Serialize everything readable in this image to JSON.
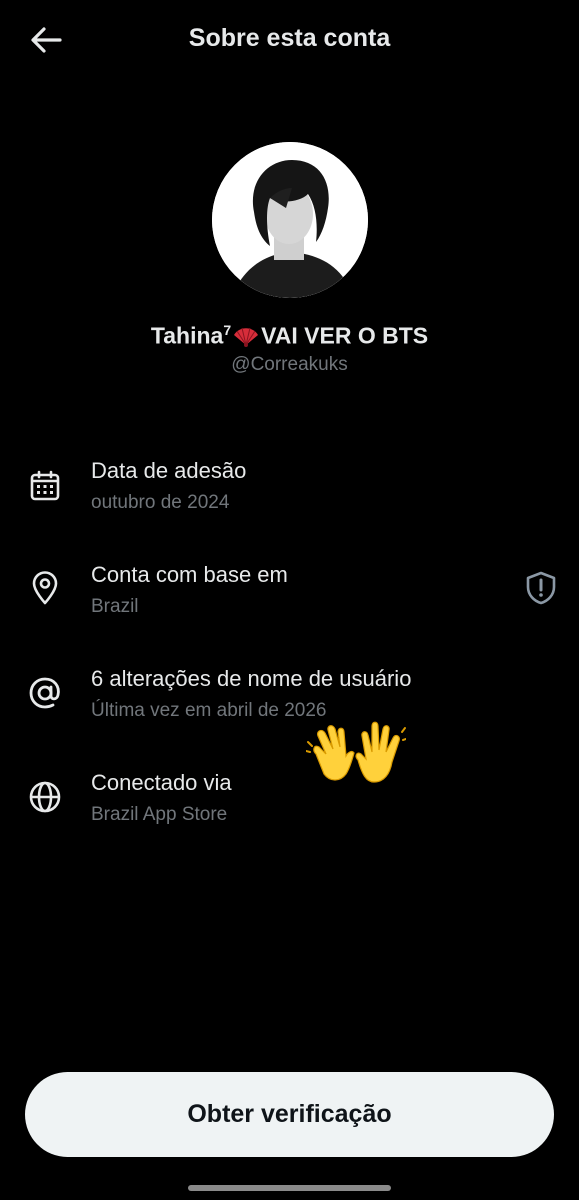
{
  "header": {
    "title": "Sobre esta conta",
    "back_icon": "arrow-left-icon"
  },
  "profile": {
    "name_prefix": "Tahina",
    "name_superscript": "7",
    "name_emoji": "red-folding-fan",
    "name_suffix": "VAI VER O BTS",
    "handle": "@Correakuks"
  },
  "details": [
    {
      "icon": "calendar-icon",
      "title": "Data de adesão",
      "subtitle": "outubro de 2024"
    },
    {
      "icon": "location-pin-icon",
      "title": "Conta com base em",
      "subtitle": "Brazil",
      "trailing_icon": "shield-alert-icon"
    },
    {
      "icon": "at-sign-icon",
      "title": "6 alterações de nome de usuário",
      "subtitle": "Última vez em abril de 2026"
    },
    {
      "icon": "globe-icon",
      "title": "Conectado via",
      "subtitle": "Brazil App Store"
    }
  ],
  "overlay_emoji": "waving-hands",
  "footer": {
    "verify_label": "Obter verificação"
  },
  "colors": {
    "background": "#000000",
    "primary_text": "#e7e9ea",
    "secondary_text": "#71767b",
    "button_bg": "#eff3f4",
    "button_text": "#0f1419"
  }
}
